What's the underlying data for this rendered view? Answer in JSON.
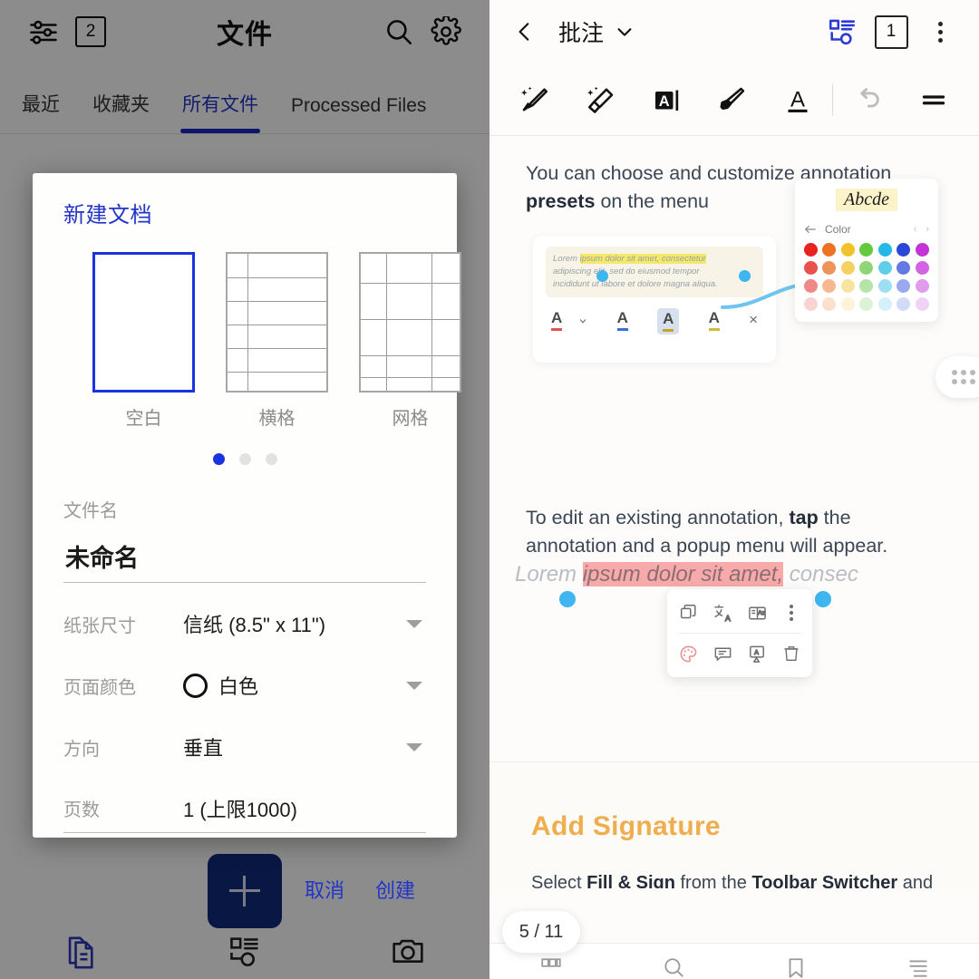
{
  "left": {
    "appbar": {
      "filter_icon": "sliders-icon",
      "count_badge": "2",
      "title": "文件",
      "search_icon": "search-icon",
      "settings_icon": "gear-icon"
    },
    "tabs": [
      {
        "label": "最近",
        "active": false
      },
      {
        "label": "收藏夹",
        "active": false
      },
      {
        "label": "所有文件",
        "active": true
      },
      {
        "label": "Processed Files",
        "active": false
      }
    ],
    "fab": {
      "icon": "plus-icon"
    },
    "bottom_nav": [
      {
        "name": "documents",
        "icon": "documents-icon",
        "active": true
      },
      {
        "name": "tools",
        "icon": "tools-list-icon",
        "active": false
      },
      {
        "name": "camera",
        "icon": "camera-icon",
        "active": false
      }
    ]
  },
  "dialog": {
    "title": "新建文档",
    "templates": [
      {
        "label": "空白",
        "type": "blank",
        "selected": true
      },
      {
        "label": "横格",
        "type": "lined",
        "selected": false
      },
      {
        "label": "网格",
        "type": "grid",
        "selected": false
      }
    ],
    "pager": {
      "count": 3,
      "current": 0
    },
    "fields": {
      "filename_label": "文件名",
      "filename_value": "未命名",
      "paper_size_label": "纸张尺寸",
      "paper_size_value": "信纸 (8.5\" x 11\")",
      "page_color_label": "页面颜色",
      "page_color_value": "白色",
      "page_color_swatch": "#ffffff",
      "orientation_label": "方向",
      "orientation_value": "垂直",
      "pages_label": "页数",
      "pages_value": "1 (上限1000)"
    },
    "actions": {
      "cancel": "取消",
      "create": "创建"
    },
    "accent": "#2334c9"
  },
  "right": {
    "appbar": {
      "back_icon": "chevron-left-icon",
      "title": "批注",
      "dropdown_icon": "chevron-down-icon",
      "outline_icon": "page-organize-icon",
      "page_badge": "1",
      "more_icon": "kebab-menu-icon"
    },
    "toolbar": [
      {
        "name": "ai-pen",
        "icon": "ai-pen-icon"
      },
      {
        "name": "ai-eraser",
        "icon": "ai-eraser-icon"
      },
      {
        "name": "text-box",
        "icon": "text-box-icon"
      },
      {
        "name": "highlighter",
        "icon": "highlighter-icon"
      },
      {
        "name": "underline-text",
        "icon": "underline-text-icon"
      },
      {
        "name": "undo",
        "icon": "undo-icon"
      },
      {
        "name": "more-tools",
        "icon": "equals-menu-icon"
      }
    ],
    "doc": {
      "p1_a": "You can choose and customize annotation ",
      "p1_b": "presets",
      "p1_c": " on the menu",
      "p2_a": "To edit an existing annotation, ",
      "p2_b": "tap",
      "p2_c": " the annotation and a popup menu will appear.",
      "mini_line1_plain": "Lorem ",
      "mini_line1_hl": "ipsum dolor sit amet, consectetur",
      "mini_line2": "adipiscing elit, sed do eiusmod tempor",
      "mini_line3": "incididunt ut labore et dolore magna aliqua.",
      "annot_tools": [
        "A",
        "A",
        "A",
        "A",
        "×"
      ],
      "color_popup": {
        "preview_text": "Abcde",
        "back_icon": "arrow-left-icon",
        "heading": "Color",
        "swatch_rows": [
          [
            "#e8221e",
            "#ef7223",
            "#f2c328",
            "#63c93f",
            "#22b9e8",
            "#2a47d6",
            "#c433d6"
          ],
          [
            "#e8514e",
            "#f1925b",
            "#f4d160",
            "#8ed673",
            "#5fcdec",
            "#6479e2",
            "#d263e2"
          ],
          [
            "#ef8886",
            "#f6b892",
            "#f8e3a0",
            "#b6e4a8",
            "#9cdff3",
            "#9aa9ee",
            "#e09bec"
          ],
          [
            "#f8d3d2",
            "#fbe0cd",
            "#fdf3d8",
            "#dcf1d5",
            "#d5f0fa",
            "#d3dbf8",
            "#f0d4f6"
          ]
        ]
      },
      "grid_fab_icon": "grid-dots-icon",
      "highlight_line": {
        "plain_start": "Lorem ",
        "pink": "ipsum dolor sit amet,",
        "plain_end": " consec"
      },
      "popup_menu_top": [
        "copy-icon",
        "translate-icon",
        "dictionary-icon",
        "kebab-menu-icon"
      ],
      "popup_menu_bottom": [
        "palette-icon",
        "comment-icon",
        "text-annotation-icon",
        "delete-icon"
      ],
      "signature": {
        "title": "Add Signature",
        "line_a": "Select ",
        "line_b": "Fill & Sign",
        "line_c": " from the ",
        "line_d": "Toolbar Switcher",
        "line_e": " and tap ",
        "chip_icon": "signature-icon"
      }
    },
    "page_indicator": "5 / 11",
    "bottom_bar": [
      {
        "name": "thumbnails",
        "icon": "thumbnails-icon"
      },
      {
        "name": "search",
        "icon": "search-icon"
      },
      {
        "name": "bookmark",
        "icon": "bookmark-icon"
      },
      {
        "name": "list",
        "icon": "list-icon"
      }
    ]
  }
}
